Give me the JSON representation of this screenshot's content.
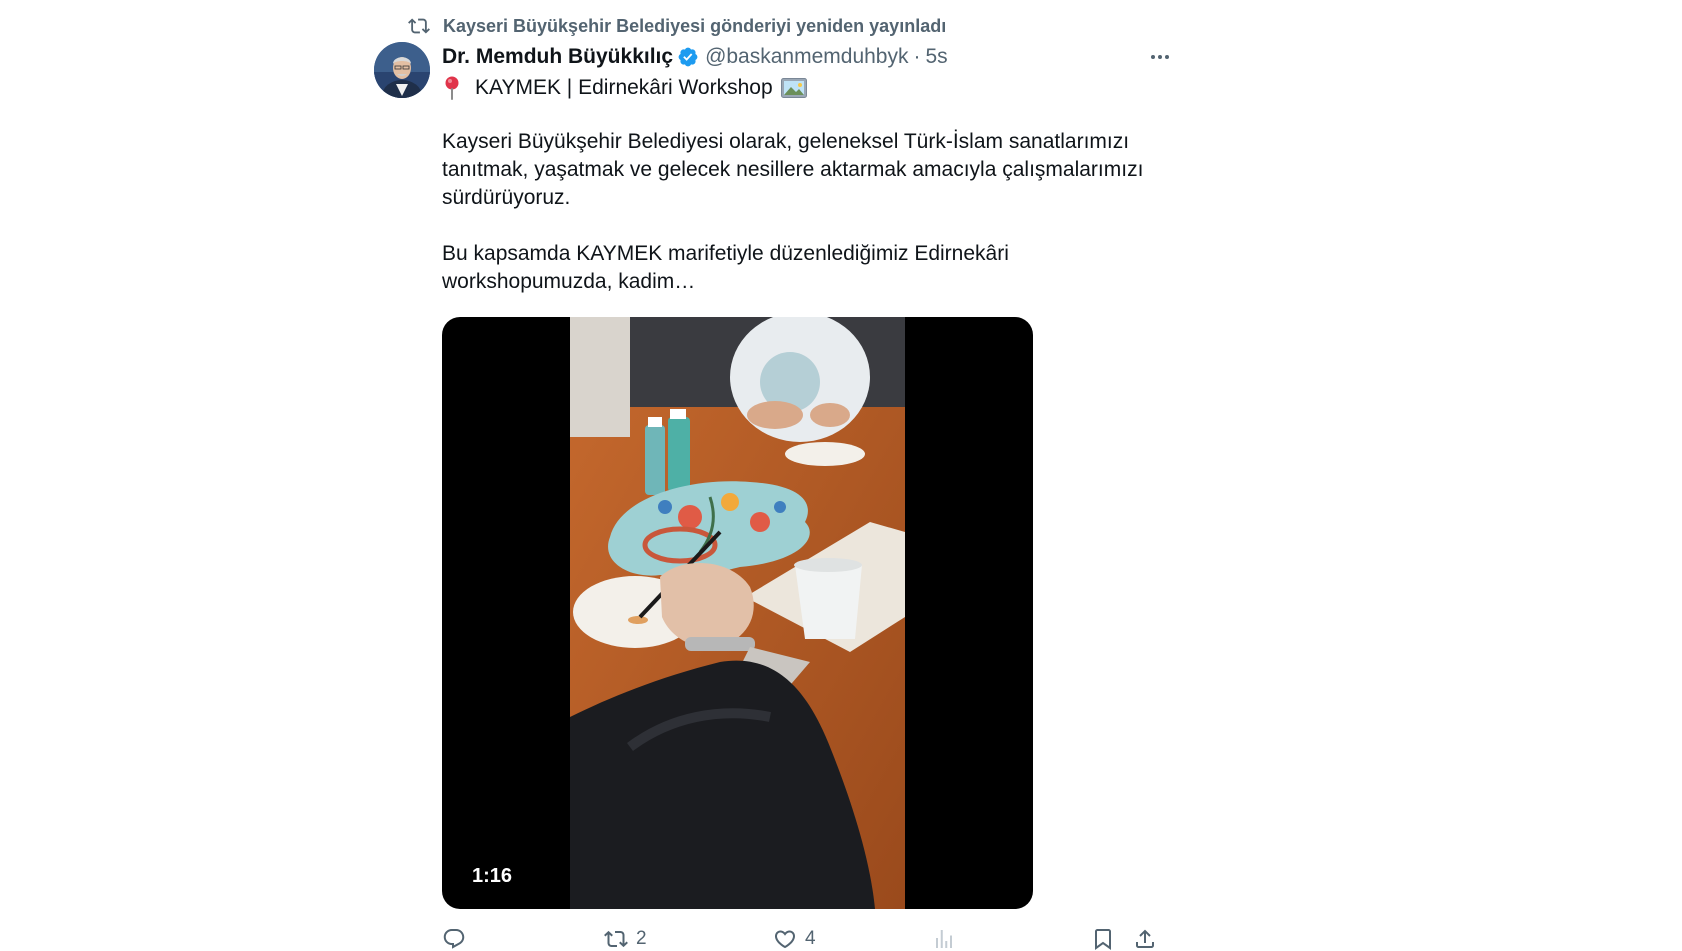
{
  "retweet": {
    "icon": "retweet-icon",
    "text": "Kayseri Büyükşehir Belediyesi gönderiyi yeniden yayınladı"
  },
  "author": {
    "display_name": "Dr. Memduh Büyükkılıç",
    "verified_icon": "verified-badge-icon",
    "handle": "@baskanmemduhbyk",
    "separator": "·",
    "time": "5s"
  },
  "more_icon": "more-icon",
  "headline": {
    "pin_icon": "round-pushpin-icon",
    "text": "KAYMEK | Edirnekâri Workshop",
    "picture_icon": "framed-picture-icon"
  },
  "body": {
    "paragraph1": "Kayseri Büyükşehir Belediyesi olarak, geleneksel Türk-İslam sanatlarımızı tanıtmak, yaşatmak ve gelecek nesillere aktarmak amacıyla çalışmalarımızı sürdürüyoruz.",
    "paragraph2": "Bu kapsamda KAYMEK marifetiyle düzenlediğimiz Edirnekâri workshopumuzda, kadim…"
  },
  "video": {
    "duration": "1:16"
  },
  "actions": {
    "reply": {
      "icon": "reply-icon",
      "count": ""
    },
    "repost": {
      "icon": "retweet-icon",
      "count": "2"
    },
    "like": {
      "icon": "heart-icon",
      "count": "4"
    },
    "views": {
      "icon": "views-chart-icon",
      "count": ""
    },
    "bookmark": {
      "icon": "bookmark-icon"
    },
    "share": {
      "icon": "share-icon"
    }
  },
  "colors": {
    "text": "#0f1419",
    "secondary": "#536471",
    "verified": "#1d9bf0",
    "background": "#ffffff"
  }
}
